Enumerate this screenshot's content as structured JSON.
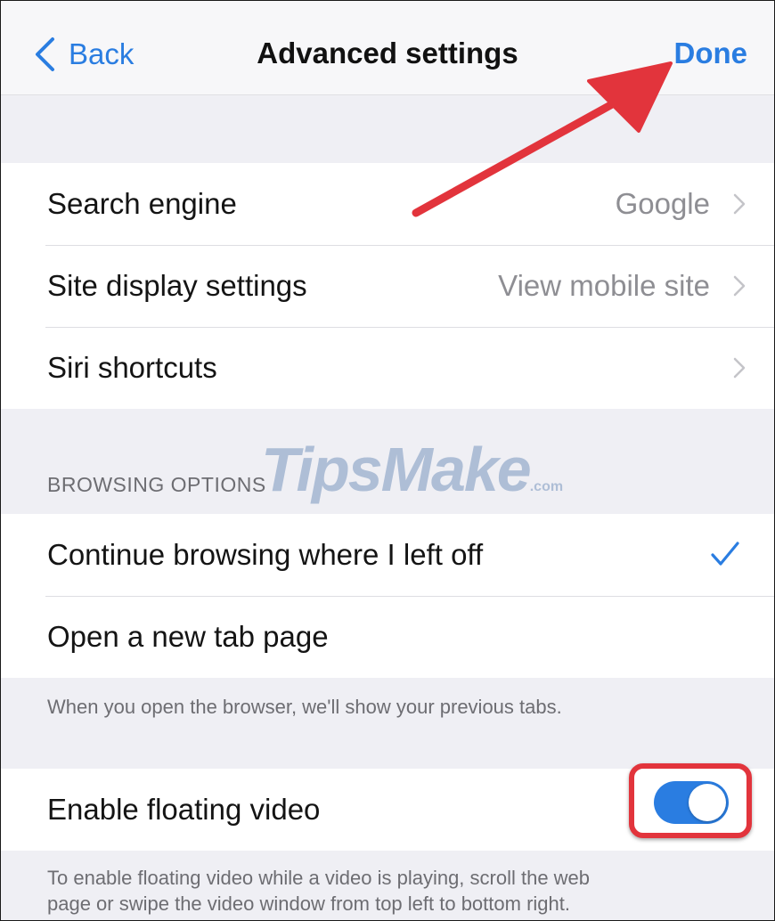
{
  "nav": {
    "back_label": "Back",
    "title": "Advanced settings",
    "done_label": "Done"
  },
  "group1": {
    "items": [
      {
        "label": "Search engine",
        "value": "Google"
      },
      {
        "label": "Site display settings",
        "value": "View mobile site"
      },
      {
        "label": "Siri shortcuts",
        "value": ""
      }
    ]
  },
  "browsing": {
    "header": "BROWSING OPTIONS",
    "items": [
      {
        "label": "Continue browsing where I left off",
        "selected": true
      },
      {
        "label": "Open a new tab page",
        "selected": false
      }
    ],
    "footnote": "When you open the browser, we'll show your previous tabs."
  },
  "floating_video": {
    "label": "Enable floating video",
    "enabled": true,
    "footnote_line1": "To enable floating video while a video is playing, scroll the web",
    "footnote_line2": "page or swipe the video window from top left to bottom right."
  },
  "watermark": {
    "text": "TipsMake",
    "suffix": ".com"
  },
  "colors": {
    "accent": "#2a7de1",
    "highlight": "#e2343c",
    "background": "#efeff4"
  },
  "icons": {
    "back": "chevron-left-icon",
    "disclosure": "chevron-right-icon",
    "selected": "checkmark-icon"
  }
}
